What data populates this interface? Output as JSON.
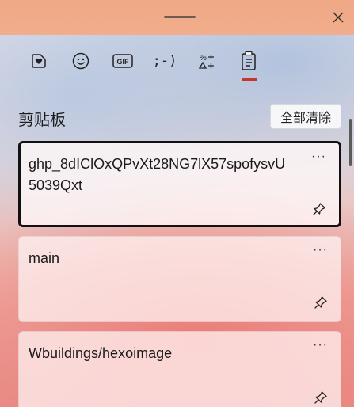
{
  "window": {
    "tabs": [
      {
        "name": "tab-stickers",
        "icon": "sticker-heart-icon"
      },
      {
        "name": "tab-emoji",
        "icon": "emoji-icon"
      },
      {
        "name": "tab-gif",
        "icon": "gif-icon",
        "label": "GIF"
      },
      {
        "name": "tab-kaomoji",
        "icon": "kaomoji-icon",
        "label": ";-)"
      },
      {
        "name": "tab-symbols",
        "icon": "symbols-icon"
      },
      {
        "name": "tab-clipboard",
        "icon": "clipboard-icon"
      }
    ],
    "active_tab": "tab-clipboard",
    "accent_color": "#c0392b"
  },
  "clipboard": {
    "heading": "剪贴板",
    "clear_all_label": "全部清除",
    "items": [
      {
        "text": "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",
        "selected": true
      },
      {
        "text": "main",
        "selected": false
      },
      {
        "text": "Wbuildings/hexoimage",
        "selected": false
      }
    ],
    "more_label": "···"
  }
}
